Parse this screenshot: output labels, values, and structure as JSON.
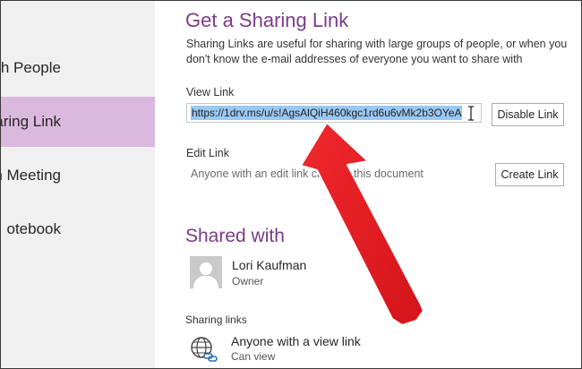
{
  "sidebar": {
    "items": [
      {
        "label": "ith People",
        "selected": false
      },
      {
        "label": "haring Link",
        "selected": true
      },
      {
        "label": "ith Meeting",
        "selected": false
      },
      {
        "label": "otebook",
        "selected": false
      }
    ]
  },
  "sharing": {
    "title": "Get a Sharing Link",
    "description": "Sharing Links are useful for sharing with large groups of people, or when you don't know the e-mail addresses of everyone you want to share with",
    "view_link_label": "View Link",
    "view_link_url": "https://1drv.ms/u/s!AgsAlQiH460kgc1rd6u6vMk2b3OYeA",
    "disable_link_label": "Disable Link",
    "edit_link_label": "Edit Link",
    "edit_link_text": "Anyone with an edit link can edit this document",
    "create_link_label": "Create Link"
  },
  "shared_with": {
    "title": "Shared with",
    "people": [
      {
        "name": "Lori Kaufman",
        "role": "Owner",
        "icon": "user-avatar-icon"
      }
    ],
    "sharing_links_label": "Sharing links",
    "links": [
      {
        "name": "Anyone with a view link",
        "permission": "Can view",
        "icon": "globe-link-icon"
      }
    ]
  },
  "colors": {
    "accent": "#7b3b89",
    "selected_bg": "#dbb9de",
    "selection_highlight": "#99c9f3",
    "annotation_arrow": "#e8191e"
  }
}
